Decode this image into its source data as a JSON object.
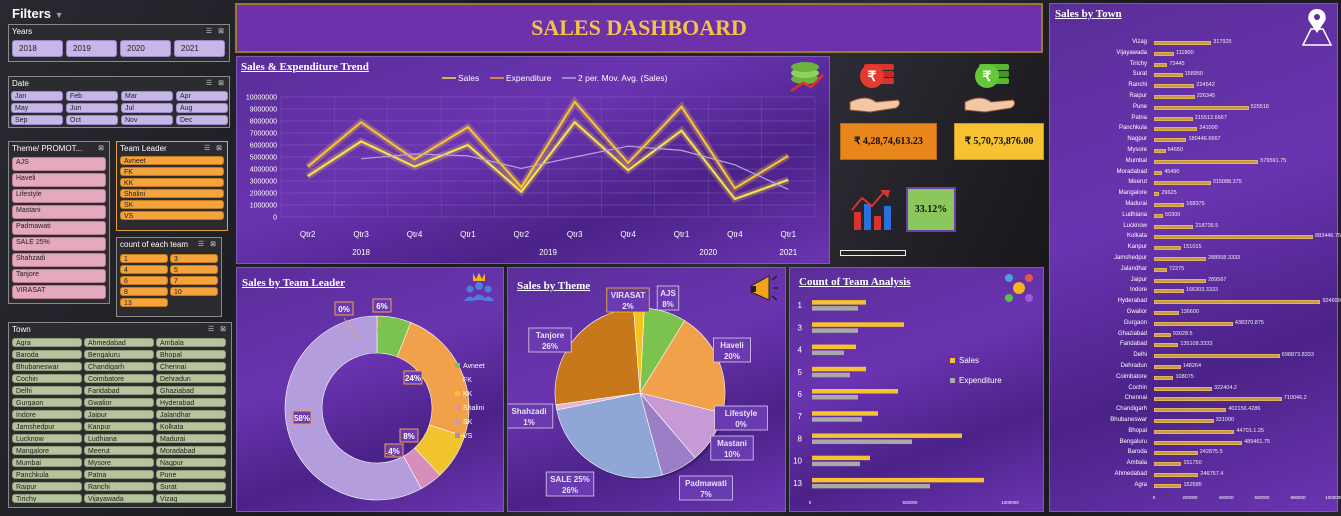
{
  "filters": {
    "title": "Filters",
    "years": {
      "label": "Years",
      "items": [
        "2018",
        "2019",
        "2020",
        "2021"
      ]
    },
    "date": {
      "label": "Date",
      "items": [
        "Jan",
        "Feb",
        "Mar",
        "Apr",
        "May",
        "Jun",
        "Jul",
        "Aug",
        "Sep",
        "Oct",
        "Nov",
        "Dec"
      ]
    },
    "theme": {
      "label": "Theme/ PROMOT...",
      "items": [
        "AJS",
        "Haveli",
        "Lifestyle",
        "Mastani",
        "Padmawati",
        "SALE 25%",
        "Shahzadi",
        "Tanjore",
        "VIRASAT"
      ]
    },
    "team_leader": {
      "label": "Team Leader",
      "items": [
        "Avneet",
        "FK",
        "KK",
        "Shalini",
        "SK",
        "VS"
      ]
    },
    "team_count": {
      "label": "count of each team",
      "items": [
        "1",
        "3",
        "4",
        "5",
        "6",
        "7",
        "8",
        "10",
        "13"
      ]
    },
    "town": {
      "label": "Town",
      "items": [
        "Agra",
        "Ahmedabad",
        "Ambala",
        "Baroda",
        "Bengaluru",
        "Bhopal",
        "Bhubaneswar",
        "Chandigarh",
        "Chennai",
        "Cochin",
        "Coimbatore",
        "Dehradun",
        "Delhi",
        "Faridabad",
        "Ghaziabad",
        "Gurgaon",
        "Gwalior",
        "Hyderabad",
        "Indore",
        "Jaipur",
        "Jalandhar",
        "Jamshedpur",
        "Kanpur",
        "Kolkata",
        "Lucknow",
        "Ludhiana",
        "Madurai",
        "Mangalore",
        "Meerut",
        "Moradabad",
        "Mumbai",
        "Mysore",
        "Nagpur",
        "Panchkula",
        "Patna",
        "Pune",
        "Raipur",
        "Ranchi",
        "Surat",
        "Tirichy",
        "Vijayawada",
        "Vizag"
      ]
    }
  },
  "header": {
    "title": "SALES DASHBOARD"
  },
  "kpi": {
    "sales": "₹ 4,28,74,613.23",
    "expenditure": "₹ 5,70,73,876.00",
    "ratio": "33.12%"
  },
  "colors": {
    "panel": "#5e2fa3",
    "gold": "#f4c542",
    "orange": "#e8851b",
    "lavender": "#b7a3df"
  },
  "chart_data": [
    {
      "id": "trend",
      "type": "line",
      "title": "Sales & Expenditure Trend",
      "legend": [
        "Sales",
        "Expenditure",
        "2 per. Mov. Avg. (Sales)"
      ],
      "x": [
        "Qtr2",
        "Qtr3",
        "Qtr4",
        "Qtr1",
        "Qtr2",
        "Qtr3",
        "Qtr4",
        "Qtr1",
        "Qtr4",
        "Qtr1"
      ],
      "year_groups": [
        {
          "label": "2018",
          "span": 3
        },
        {
          "label": "2019",
          "span": 4
        },
        {
          "label": "2020",
          "span": 2
        },
        {
          "label": "2021",
          "span": 1
        }
      ],
      "ylim": [
        0,
        10000000
      ],
      "yticks": [
        "0",
        "1000000",
        "2000000",
        "3000000",
        "4000000",
        "5000000",
        "6000000",
        "7000000",
        "8000000",
        "9000000",
        "10000000"
      ],
      "series": [
        {
          "name": "Sales",
          "values": [
            3400000,
            6300000,
            4200000,
            6000000,
            2100000,
            7900000,
            3900000,
            7200000,
            1500000,
            3100000
          ]
        },
        {
          "name": "Expenditure",
          "values": [
            4200000,
            7900000,
            4800000,
            7500000,
            2500000,
            9600000,
            4500000,
            9200000,
            2400000,
            5100000
          ]
        },
        {
          "name": "2 per. Mov. Avg. (Sales)",
          "values": [
            null,
            4850000,
            5250000,
            5100000,
            4050000,
            5000000,
            5900000,
            5550000,
            4350000,
            2300000
          ]
        }
      ]
    },
    {
      "id": "team_leader",
      "type": "pie",
      "title": "Sales by Team Leader",
      "categories": [
        "Avneet",
        "FK",
        "KK",
        "Shalini",
        "SK",
        "VS"
      ],
      "values": [
        6,
        24,
        8,
        4,
        58,
        0
      ],
      "labels": [
        "6%",
        "24%",
        "8%",
        "4%",
        "58%",
        "0%"
      ],
      "colors": [
        "#7cc24e",
        "#f0a14a",
        "#f0c42a",
        "#d58fb8",
        "#b39ddc",
        "#8b96c9"
      ]
    },
    {
      "id": "theme",
      "type": "pie",
      "title": "Sales by Theme",
      "categories": [
        "AJS",
        "Haveli",
        "Lifestyle",
        "Mastani",
        "Padmawati",
        "SALE 25%",
        "Shahzadi",
        "Tanjore",
        "VIRASAT"
      ],
      "values": [
        8,
        20,
        0,
        10,
        7,
        26,
        1,
        26,
        2
      ],
      "labels": [
        "AJS\n8%",
        "Haveli\n20%",
        "Lifestyle\n0%",
        "Mastani\n10%",
        "Padmawati\n7%",
        "SALE 25%\n26%",
        "Shahzadi\n1%",
        "Tanjore\n26%",
        "VIRASAT\n2%"
      ],
      "colors": [
        "#7cc24e",
        "#f0a14a",
        "#f2c14e",
        "#c79ad6",
        "#9b7fc6",
        "#8fa6d6",
        "#e5b6ce",
        "#c8771b",
        "#f5c21b"
      ]
    },
    {
      "id": "team_count",
      "type": "bar",
      "title": "Count of Team Analysis",
      "categories": [
        "1",
        "3",
        "4",
        "5",
        "6",
        "7",
        "8",
        "10",
        "13"
      ],
      "series": [
        {
          "name": "Sales",
          "values": [
            270000,
            460000,
            220000,
            270000,
            430000,
            330000,
            750000,
            290000,
            860000
          ]
        },
        {
          "name": "Expenditure",
          "values": [
            230000,
            230000,
            160000,
            190000,
            230000,
            250000,
            500000,
            240000,
            590000
          ]
        }
      ],
      "xlim": [
        0,
        1000000
      ],
      "xticks": [
        "0",
        "500000",
        "1000000"
      ]
    },
    {
      "id": "town",
      "type": "bar",
      "title": "Sales by Town",
      "categories": [
        "Vizag",
        "Vijayawada",
        "Tirichy",
        "Surat",
        "Ranchi",
        "Raipur",
        "Pune",
        "Patna",
        "Panchkula",
        "Nagpur",
        "Mysore",
        "Mumbai",
        "Moradabad",
        "Meerut",
        "Mangalore",
        "Madurai",
        "Ludhiana",
        "Lucknow",
        "Kolkata",
        "Kanpur",
        "Jamshedpur",
        "Jalandhar",
        "Jaipur",
        "Indore",
        "Hyderabad",
        "Gwalior",
        "Gurgaon",
        "Ghaziabad",
        "Faridabad",
        "Delhi",
        "Dehradun",
        "Coimbatore",
        "Cochin",
        "Chennai",
        "Chandigarh",
        "Bhubaneswar",
        "Bhopal",
        "Bengaluru",
        "Baroda",
        "Ambala",
        "Ahmedabad",
        "Agra"
      ],
      "values": [
        317925,
        111800,
        73445,
        158950,
        224542,
        226345,
        525518,
        215512.6667,
        241000,
        180446.6667,
        64650,
        579591.75,
        45490,
        315088.375,
        29625,
        168375,
        50300,
        218735.5,
        883446.75,
        151015,
        288958.3333,
        72275,
        289567,
        166303.3333,
        924699.6,
        136600,
        438370.875,
        93028.5,
        135108.3333,
        698873.8333,
        148264,
        108075,
        322404.2,
        710046.2,
        402156.4286,
        331000,
        447011.25,
        489461.75,
        242875.5,
        151750,
        246757.4,
        152685
      ],
      "labels": [
        "317925",
        "111800",
        "73445",
        "158950",
        "224542",
        "226345",
        "525518",
        "215512.6667",
        "241000",
        "180446.6667",
        "64650",
        "579591.75",
        "45490",
        "315088.375",
        "29625",
        "168375",
        "50300",
        "218735.5",
        "883446.75",
        "151015",
        "288958.3333",
        "72275",
        "289567",
        "166303.3333",
        "924699.6",
        "136600",
        "438370.875",
        "93028.5",
        "135108.3333",
        "698873.8333",
        "148264",
        "108075",
        "322404.2",
        "710046.2",
        "402156.4286",
        "331000",
        "44701.1.25",
        "489461.75",
        "242875.5",
        "151750",
        "246757.4",
        "152685"
      ],
      "xlim": [
        0,
        1000000
      ],
      "xticks": [
        "0",
        "200000",
        "400000",
        "600000",
        "800000",
        "1000000"
      ]
    }
  ]
}
